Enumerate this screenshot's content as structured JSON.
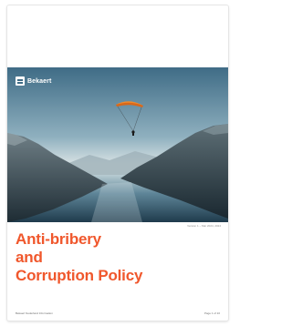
{
  "brand": {
    "name": "Bekaert"
  },
  "cover": {
    "version_date": "Version 1 – Mar 2024, 2024"
  },
  "title": {
    "line1": "Anti-bribery",
    "line2": "and",
    "line3": "Corruption Policy"
  },
  "footer": {
    "left": "Bekaert Nederland Information",
    "right": "Page 1 of 10"
  },
  "colors": {
    "accent": "#f0572c",
    "sky": "#4a7590",
    "paraglider": "#f08a2c"
  }
}
